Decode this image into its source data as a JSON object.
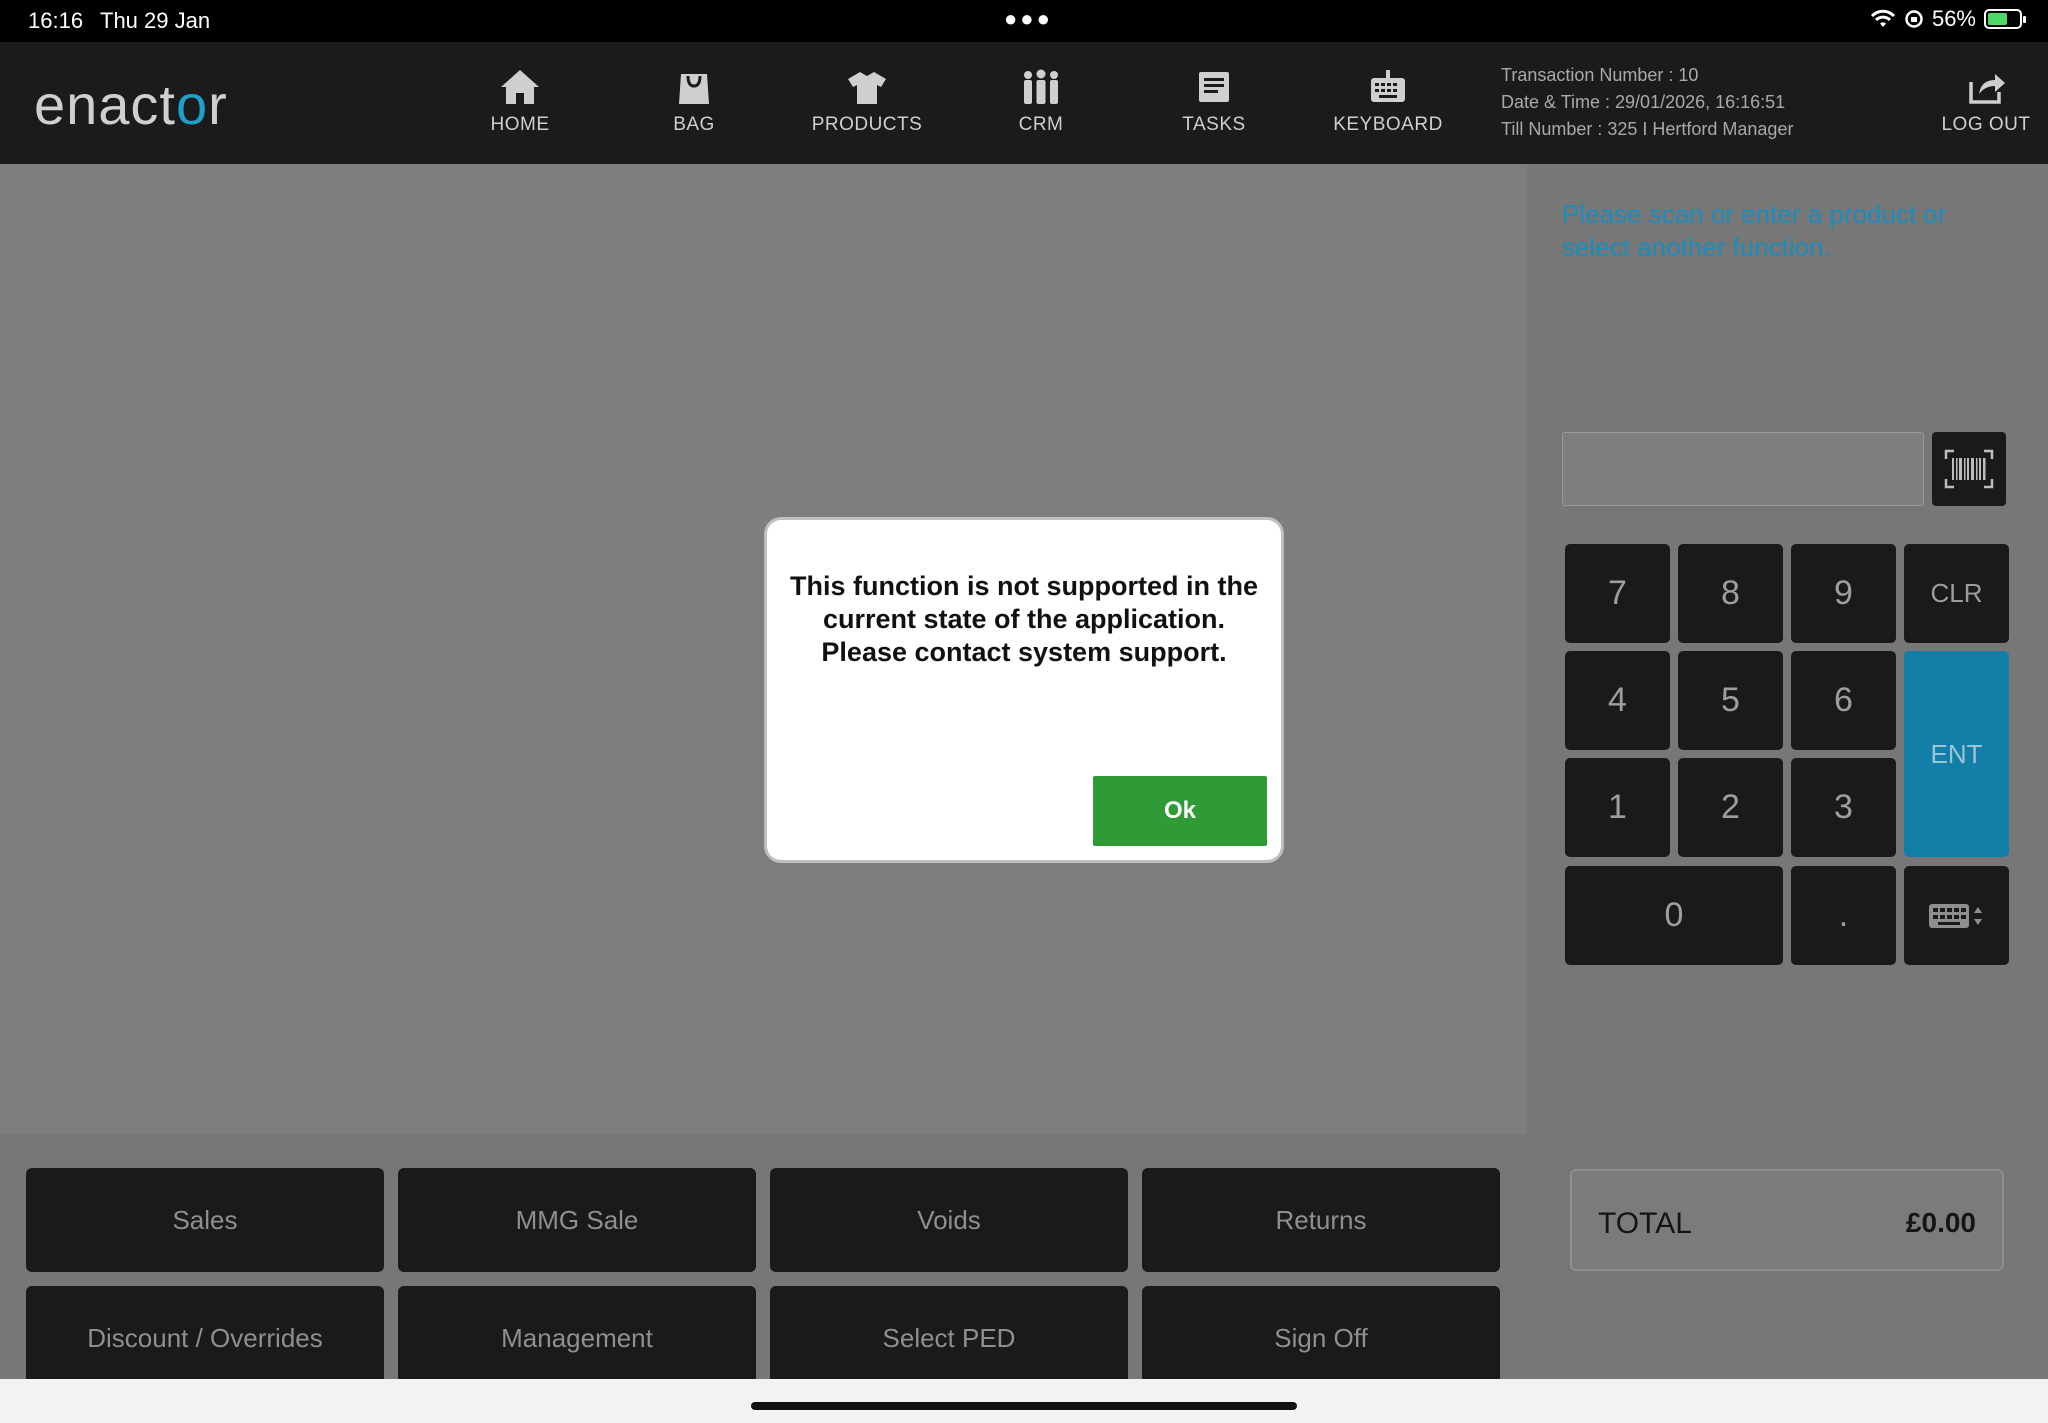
{
  "status_bar": {
    "time": "16:16",
    "date": "Thu 29 Jan",
    "battery": "56%",
    "icons": [
      "ellipsis-icon",
      "wifi-icon",
      "orientation-lock-icon",
      "battery-charging-icon"
    ]
  },
  "header": {
    "logo_text_pre": "enact",
    "logo_text_o": "o",
    "logo_text_post": "r",
    "nav": [
      {
        "label": "HOME",
        "icon": "home-icon"
      },
      {
        "label": "BAG",
        "icon": "bag-icon"
      },
      {
        "label": "PRODUCTS",
        "icon": "shirt-icon"
      },
      {
        "label": "CRM",
        "icon": "people-icon"
      },
      {
        "label": "TASKS",
        "icon": "tasks-icon"
      },
      {
        "label": "KEYBOARD",
        "icon": "keyboard-icon"
      }
    ],
    "transaction_number": "Transaction Number : 10",
    "date_time": "Date & Time : 29/01/2026, 16:16:51",
    "till_line": "Till Number : 325  I  Hertford Manager",
    "logout": {
      "label": "LOG OUT",
      "icon": "logout-icon"
    }
  },
  "sidebar": {
    "prompt": "Please scan or enter a product or select another function.",
    "scan_input_value": "",
    "scan_button_icon": "barcode-scan-icon",
    "keypad": [
      "7",
      "8",
      "9",
      "CLR",
      "4",
      "5",
      "6",
      "ENT",
      "1",
      "2",
      "3",
      "0",
      "."
    ],
    "keypad_toggle_icon": "keyboard-toggle-icon",
    "total_label": "TOTAL",
    "total_value": "£0.00"
  },
  "function_buttons": [
    "Sales",
    "MMG Sale",
    "Voids",
    "Returns",
    "Discount / Overrides",
    "Management",
    "Select PED",
    "Sign Off"
  ],
  "dialog": {
    "message_line1": "This function is not supported in the",
    "message_line2": "current state of the application.",
    "message_line3": "Please contact system support.",
    "ok_label": "Ok"
  },
  "colors": {
    "accent": "#1a8dbd",
    "ent_key": "#137fa8",
    "ok_button": "#2f9a36",
    "header_bg": "#1b1b1b",
    "overlay_bg": "#7e7e7e"
  }
}
